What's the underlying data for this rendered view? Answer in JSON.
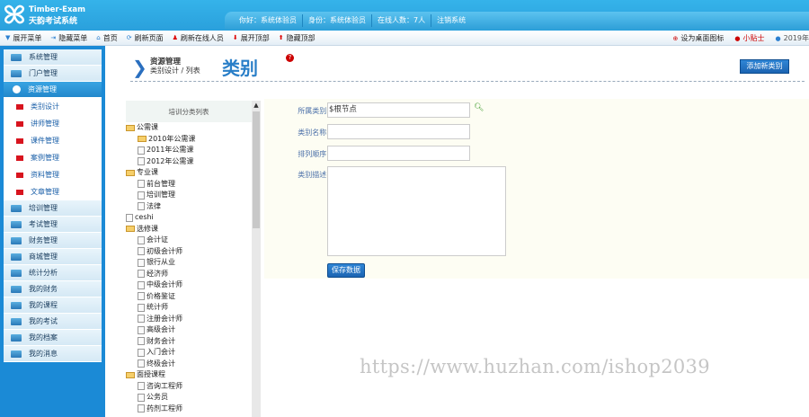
{
  "header": {
    "brand_en": "Timber-Exam",
    "brand_cn": "天韵考试系统",
    "user": [
      "你好：系统体验员",
      "身份：系统体验员",
      "在线人数：7人",
      "注销系统"
    ]
  },
  "toolbar": {
    "left": [
      "展开菜单",
      "隐藏菜单",
      "首页",
      "刷新页面",
      "刷新在线人员",
      "展开顶部",
      "隐藏顶部"
    ],
    "right": [
      "设为桌面图标",
      "小贴士",
      "2019年"
    ]
  },
  "sidebar": {
    "top": [
      "系统管理",
      "门户管理"
    ],
    "active": "资源管理",
    "sub": [
      "类别设计",
      "讲师管理",
      "课件管理",
      "案例管理",
      "资料管理",
      "文章管理"
    ],
    "bottom": [
      "培训管理",
      "考试管理",
      "财务管理",
      "商城管理",
      "统计分析",
      "我的财务",
      "我的课程",
      "我的考试",
      "我的档案",
      "我的消息"
    ]
  },
  "page": {
    "section": "资源管理",
    "breadcrumb": "类别设计 / 列表",
    "title": "类别",
    "add_button": "添加新类别"
  },
  "tree": {
    "header": "培训分类列表",
    "nodes": [
      {
        "t": "公需课",
        "l": 0,
        "k": "open"
      },
      {
        "t": "2010年公需课",
        "l": 1,
        "k": "folder"
      },
      {
        "t": "2011年公需课",
        "l": 1,
        "k": "file"
      },
      {
        "t": "2012年公需课",
        "l": 1,
        "k": "file"
      },
      {
        "t": "专业课",
        "l": 0,
        "k": "open"
      },
      {
        "t": "前台管理",
        "l": 1,
        "k": "file"
      },
      {
        "t": "培训管理",
        "l": 1,
        "k": "file"
      },
      {
        "t": "法律",
        "l": 1,
        "k": "file"
      },
      {
        "t": "ceshi",
        "l": 0,
        "k": "file"
      },
      {
        "t": "选修课",
        "l": 0,
        "k": "open"
      },
      {
        "t": "会计证",
        "l": 1,
        "k": "file"
      },
      {
        "t": "初级会计师",
        "l": 1,
        "k": "file"
      },
      {
        "t": "银行从业",
        "l": 1,
        "k": "file"
      },
      {
        "t": "经济师",
        "l": 1,
        "k": "file"
      },
      {
        "t": "中级会计师",
        "l": 1,
        "k": "file"
      },
      {
        "t": "价格鉴证",
        "l": 1,
        "k": "file"
      },
      {
        "t": "统计师",
        "l": 1,
        "k": "file"
      },
      {
        "t": "注册会计师",
        "l": 1,
        "k": "file"
      },
      {
        "t": "高级会计",
        "l": 1,
        "k": "file"
      },
      {
        "t": "财务会计",
        "l": 1,
        "k": "file"
      },
      {
        "t": "入门会计",
        "l": 1,
        "k": "file"
      },
      {
        "t": "终极会计",
        "l": 1,
        "k": "file"
      },
      {
        "t": "面授课程",
        "l": 0,
        "k": "open"
      },
      {
        "t": "咨询工程师",
        "l": 1,
        "k": "file"
      },
      {
        "t": "公务员",
        "l": 1,
        "k": "file"
      },
      {
        "t": "药剂工程师",
        "l": 1,
        "k": "file"
      }
    ]
  },
  "form": {
    "parent_label": "所属类别:",
    "parent_value": "$根节点",
    "name_label": "类别名称:",
    "name_value": "",
    "order_label": "排列顺序:",
    "order_value": "",
    "desc_label": "类别描述:",
    "desc_value": "",
    "save": "保存数据"
  },
  "watermark": "https://www.huzhan.com/ishop2039"
}
